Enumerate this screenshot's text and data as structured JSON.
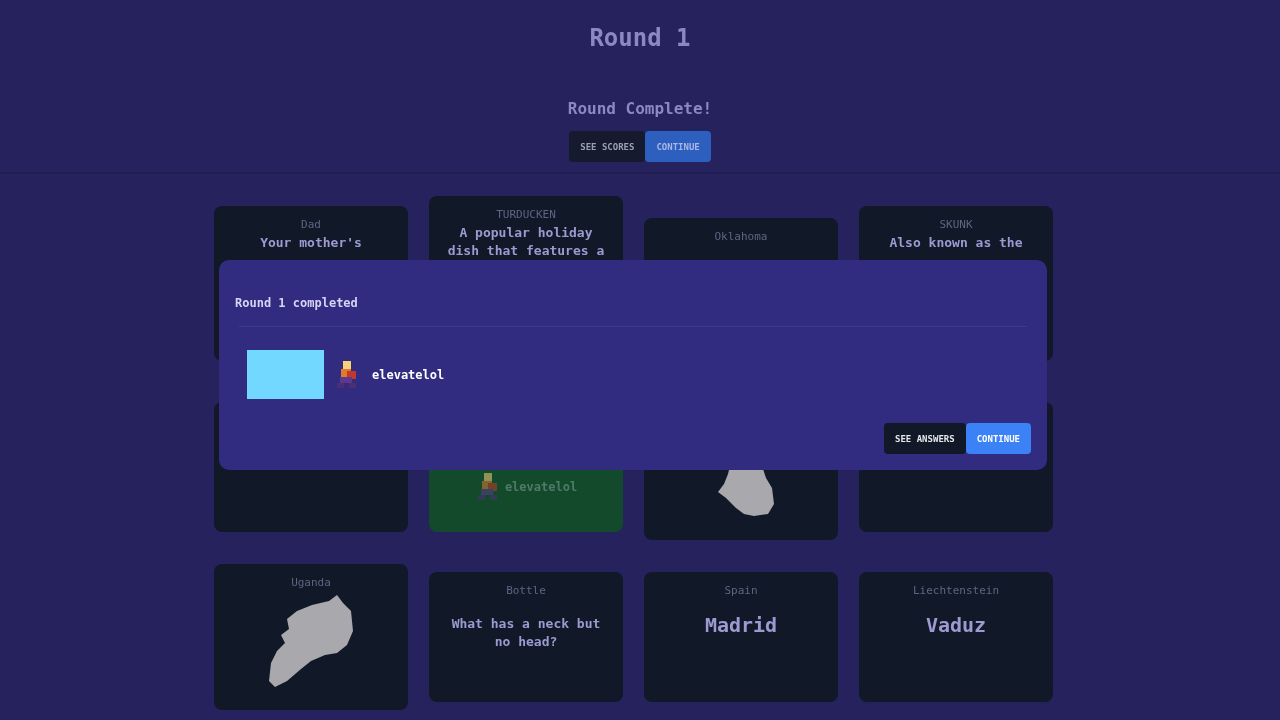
{
  "header": {
    "title": "Round 1",
    "status": "Round Complete!",
    "buttons": [
      {
        "label": "SEE SCORES",
        "kind": "secondary"
      },
      {
        "label": "CONTINUE",
        "kind": "primary"
      }
    ]
  },
  "board": {
    "cards": [
      {
        "kind": "clue",
        "category": "Dad",
        "text": "Your mother's"
      },
      {
        "kind": "clue",
        "category": "TURDUCKEN",
        "text": "A popular holiday dish that features a"
      },
      {
        "kind": "clue",
        "category": "Oklahoma"
      },
      {
        "kind": "clue",
        "category": "SKUNK",
        "text": "Also known as the"
      },
      {
        "kind": "blank"
      },
      {
        "kind": "answered",
        "player": "elevatelol"
      },
      {
        "kind": "map"
      },
      {
        "kind": "blank"
      },
      {
        "kind": "map",
        "category": "Uganda"
      },
      {
        "kind": "clue",
        "category": "Bottle",
        "text": "What has a neck but no head?"
      },
      {
        "kind": "answer",
        "category": "Spain",
        "text": "Madrid"
      },
      {
        "kind": "answer",
        "category": "Liechtenstein",
        "text": "Vaduz"
      }
    ]
  },
  "modal": {
    "title": "Round 1 completed",
    "players": [
      {
        "name": "elevatelol",
        "color": "#73d8ff"
      }
    ],
    "buttons": [
      {
        "label": "SEE ANSWERS",
        "kind": "secondary"
      },
      {
        "label": "CONTINUE",
        "kind": "primary"
      }
    ]
  }
}
